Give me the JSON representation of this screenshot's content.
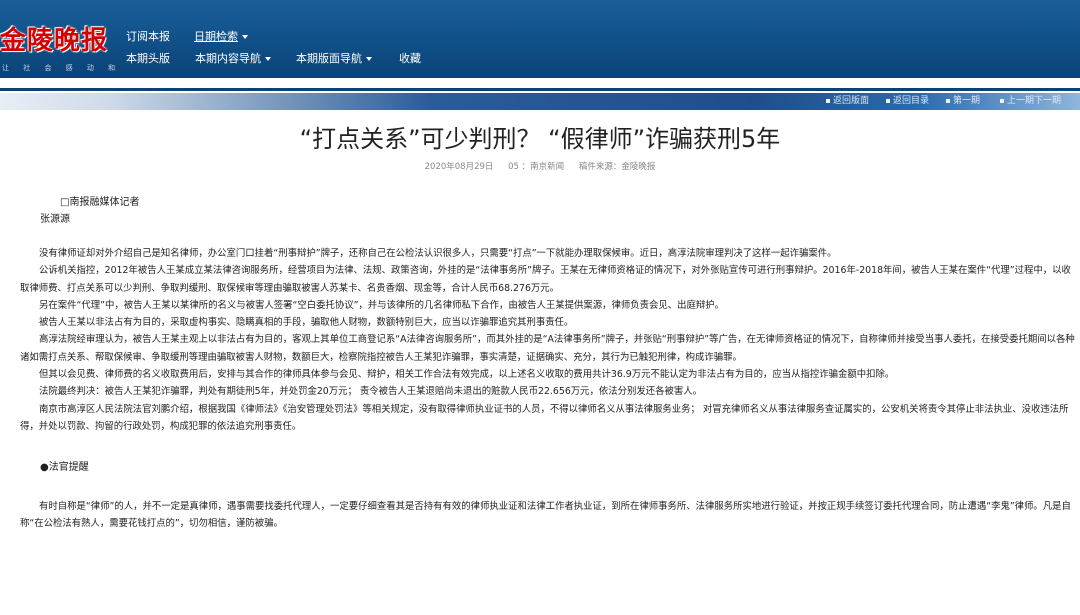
{
  "header": {
    "logo_text": "金陵晚报",
    "logo_sub": "让 社 会 感 动 和 美 丽",
    "nav_row1": [
      "订阅本报",
      "日期检索"
    ],
    "nav_row2": [
      "本期头版",
      "本期内容导航",
      "本期版面导航",
      "收藏"
    ]
  },
  "strip_links": [
    "返回版面",
    "返回目录",
    "第一期",
    "上一期下一期"
  ],
  "article": {
    "title": "“打点关系”可少判刑？ “假律师”诈骗获刑5年",
    "date": "2020年08月29日",
    "page": "05 ：南京新闻",
    "source": "稿件来源：金陵晚报",
    "byline1": "□南报融媒体记者",
    "byline2": "张源源",
    "paragraphs": [
      "没有律师证却对外介绍自己是知名律师，办公室门口挂着“刑事辩护”牌子，还称自己在公检法认识很多人，只需要“打点”一下就能办理取保候审。近日，高淳法院审理判决了这样一起诈骗案件。",
      "公诉机关指控，2012年被告人王某成立某法律咨询服务所，经营项目为法律、法规、政策咨询，外挂的是“法律事务所”牌子。王某在无律师资格证的情况下，对外张贴宣传可进行刑事辩护。2016年-2018年间，被告人王某在案件“代理”过程中，以收取律师费、打点关系可以少判刑、争取判缓刑、取保候审等理由骗取被害人苏某卡、名贵香烟、现金等，合计人民币68.276万元。",
      "另在案件“代理”中，被告人王某以某律所的名义与被害人签署“空白委托协议”，并与该律所的几名律师私下合作，由被告人王某提供案源，律师负责会见、出庭辩护。",
      "被告人王某以非法占有为目的，采取虚构事实、隐瞒真相的手段，骗取他人财物，数额特别巨大，应当以诈骗罪追究其刑事责任。",
      "高淳法院经审理认为，被告人王某主观上以非法占有为目的，客观上其单位工商登记系“A法律咨询服务所”，而其外挂的是“A法律事务所”牌子，并张贴“刑事辩护”等广告，在无律师资格证的情况下，自称律师并接受当事人委托，在接受委托期间以各种诸如需打点关系、帮取保候审、争取缓刑等理由骗取被害人财物，数额巨大，检察院指控被告人王某犯诈骗罪，事实清楚，证据确实、充分，其行为已触犯刑律，构成诈骗罪。",
      "但其以会见费、律师费的名义收取费用后，安排与其合作的律师具体参与会见、辩护，相关工作合法有效完成，以上述名义收取的费用共计36.9万元不能认定为非法占有为目的，应当从指控诈骗金额中扣除。",
      "法院最终判决：被告人王某犯诈骗罪，判处有期徒刑5年，并处罚金20万元；  责令被告人王某退赔尚未退出的赃款人民币22.656万元，依法分别发还各被害人。",
      "南京市高淳区人民法院法官刘鹏介绍，根据我国《律师法》《治安管理处罚法》等相关规定，没有取得律师执业证书的人员，不得以律师名义从事法律服务业务；  对冒充律师名义从事法律服务查证属实的，公安机关将责令其停止非法执业、没收违法所得，并处以罚款、拘留的行政处罚，构成犯罪的依法追究刑事责任。"
    ],
    "section_head": "●法官提醒",
    "closing": "有时自称是“律师”的人，并不一定是真律师，遇事需要找委托代理人，一定要仔细查看其是否持有有效的律师执业证和法律工作者执业证，到所在律师事务所、法律服务所实地进行验证，并按正规手续签订委托代理合同，防止遭遇“李鬼”律师。凡是自称“在公检法有熟人，需要花钱打点的”，切勿相信，谨防被骗。"
  }
}
